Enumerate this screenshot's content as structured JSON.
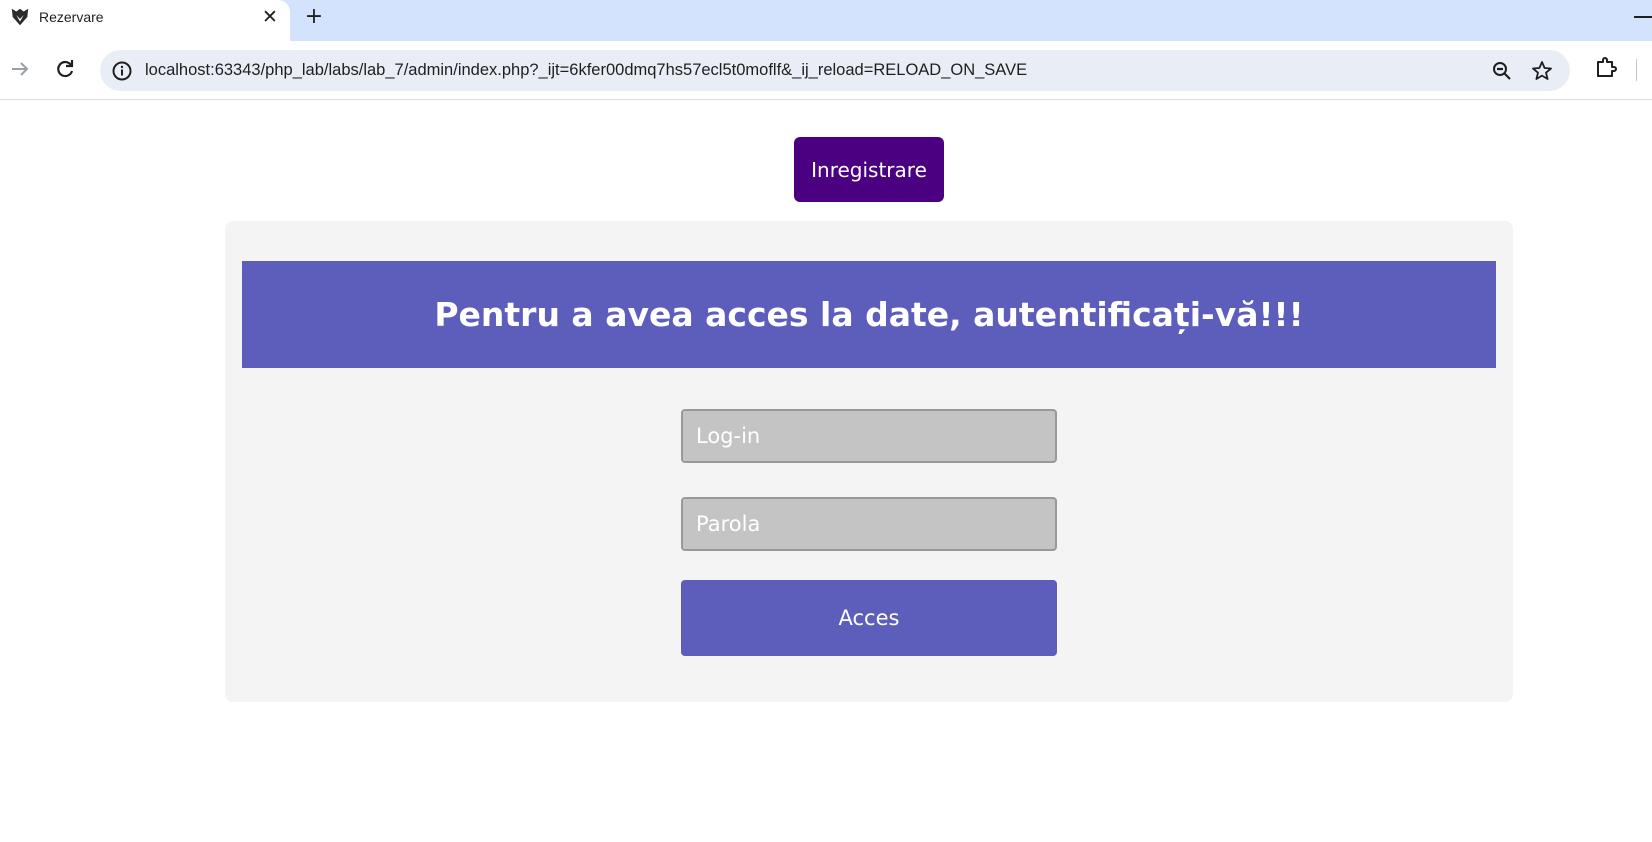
{
  "browser": {
    "tab_title": "Rezervare",
    "tab_close_glyph": "✕",
    "new_tab_glyph": "+",
    "url": "localhost:63343/php_lab/labs/lab_7/admin/index.php?_ijt=6kfer00dmq7hs57ecl5t0moflf&_ij_reload=RELOAD_ON_SAVE",
    "icons": [
      "app-favicon",
      "forward-arrow",
      "reload",
      "site-info",
      "zoom-out",
      "bookmark-star",
      "extensions-puzzle"
    ]
  },
  "page": {
    "register_label": "Inregistrare",
    "heading": "Pentru a avea acces la date, autentificați-vă!!!",
    "login_placeholder": "Log-in",
    "password_placeholder": "Parola",
    "access_label": "Acces"
  },
  "colors": {
    "register_bg": "#4b0082",
    "accent": "#5d5dbc",
    "card_bg": "#f4f4f4",
    "field_bg": "#c4c4c4",
    "tabstrip_bg": "#d3e3fd"
  }
}
